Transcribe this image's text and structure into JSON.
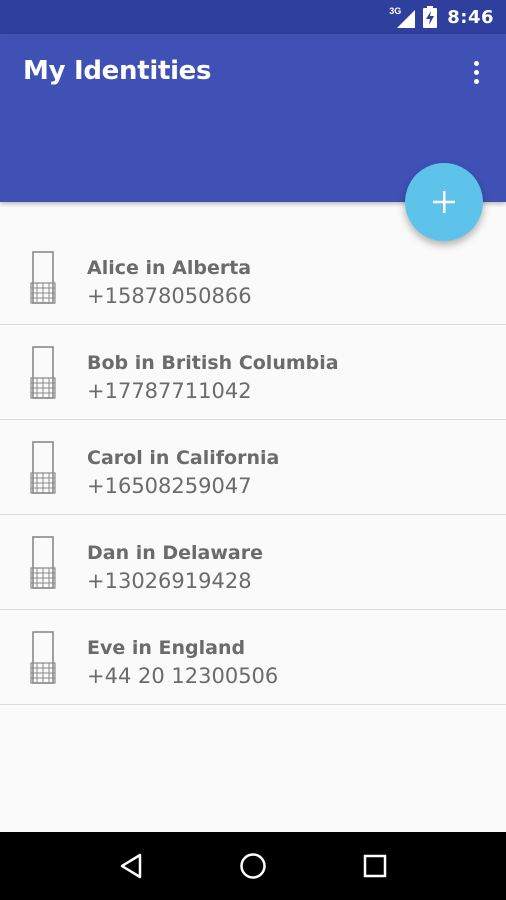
{
  "status_bar": {
    "network": "3G",
    "time": "8:46",
    "icons": [
      "signal-icon",
      "battery-charging-icon"
    ]
  },
  "app_bar": {
    "title": "My Identities",
    "overflow_icon": "more-vert-icon",
    "color": "#3f51b5"
  },
  "fab": {
    "icon": "plus-icon",
    "color": "#5ec3ea"
  },
  "identities": [
    {
      "name": "Alice in Alberta",
      "number": "+15878050866",
      "icon": "phone-icon"
    },
    {
      "name": "Bob in British Columbia",
      "number": "+17787711042",
      "icon": "phone-icon"
    },
    {
      "name": "Carol in California",
      "number": "+16508259047",
      "icon": "phone-icon"
    },
    {
      "name": "Dan in Delaware",
      "number": "+13026919428",
      "icon": "phone-icon"
    },
    {
      "name": "Eve in England",
      "number": "+44 20 12300506",
      "icon": "phone-icon"
    }
  ],
  "nav_bar": {
    "icons": [
      "back-icon",
      "home-icon",
      "recents-icon"
    ]
  }
}
